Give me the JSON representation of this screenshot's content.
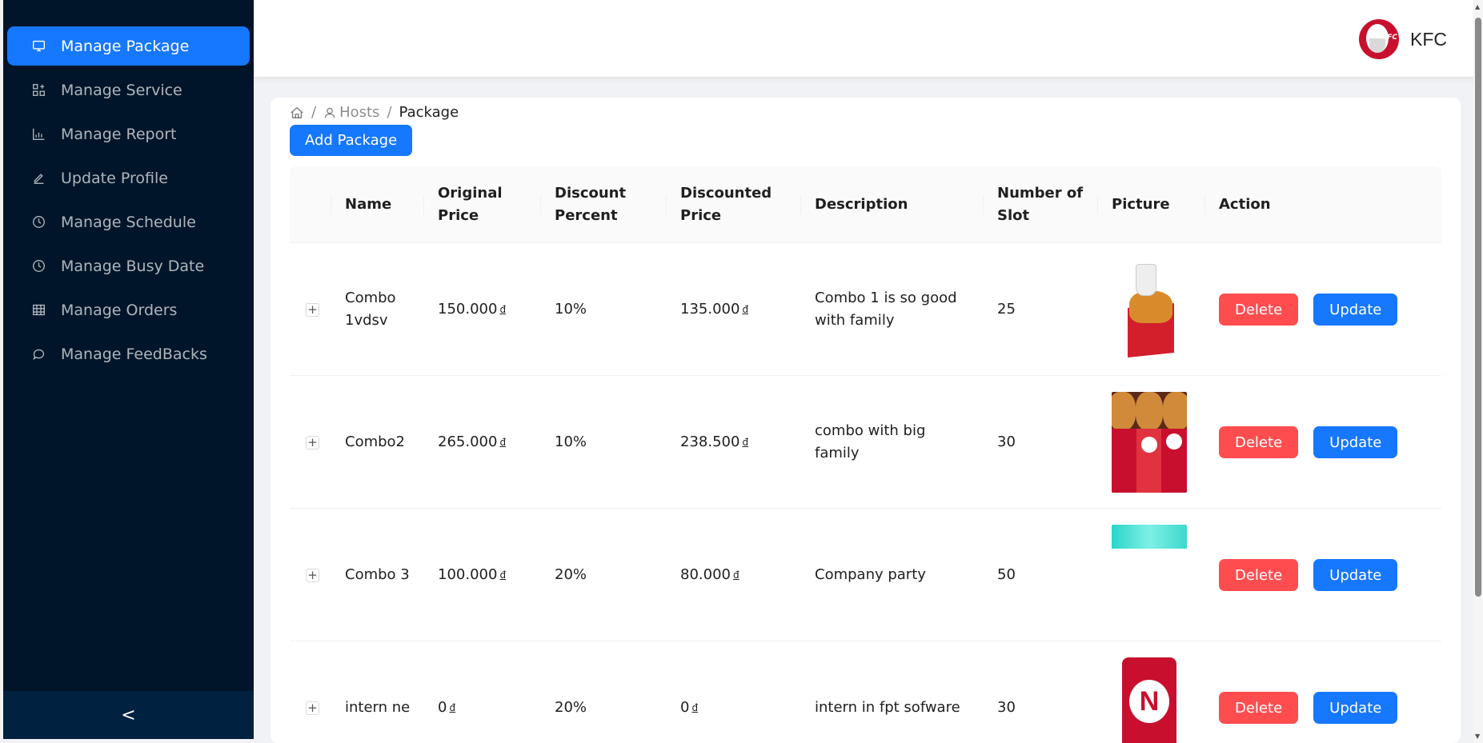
{
  "sidebar": {
    "items": [
      {
        "label": "Manage Package",
        "icon": "desktop-icon",
        "active": true
      },
      {
        "label": "Manage Service",
        "icon": "appstore-add-icon"
      },
      {
        "label": "Manage Report",
        "icon": "bar-chart-icon"
      },
      {
        "label": "Update Profile",
        "icon": "edit-icon"
      },
      {
        "label": "Manage Schedule",
        "icon": "clock-icon"
      },
      {
        "label": "Manage Busy Date",
        "icon": "clock-icon"
      },
      {
        "label": "Manage Orders",
        "icon": "table-icon"
      },
      {
        "label": "Manage FeedBacks",
        "icon": "comment-icon"
      }
    ],
    "collapse_label": "<"
  },
  "header": {
    "user_name": "KFC",
    "avatar_text": "KFC"
  },
  "breadcrumb": {
    "separator": "/",
    "items": [
      "Hosts",
      "Package"
    ]
  },
  "toolbar": {
    "add_label": "Add Package"
  },
  "table": {
    "columns": [
      "Name",
      "Original Price",
      "Discount Percent",
      "Discounted Price",
      "Description",
      "Number of Slot",
      "Picture",
      "Action"
    ],
    "rows": [
      {
        "name": "Combo 1vdsv",
        "original_price": "150.000",
        "discount": "10%",
        "discounted_price": "135.000",
        "description": "Combo 1 is so good with family",
        "slots": "25"
      },
      {
        "name": "Combo2",
        "original_price": "265.000",
        "discount": "10%",
        "discounted_price": "238.500",
        "description": "combo with big family",
        "slots": "30"
      },
      {
        "name": "Combo 3",
        "original_price": "100.000",
        "discount": "20%",
        "discounted_price": "80.000",
        "description": "Company party",
        "slots": "50"
      },
      {
        "name": "intern ne",
        "original_price": "0",
        "discount": "20%",
        "discounted_price": "0",
        "description": "intern in fpt sofware",
        "slots": "30"
      }
    ],
    "currency_symbol": "đ",
    "expand_symbol": "+",
    "delete_label": "Delete",
    "update_label": "Update"
  },
  "colors": {
    "sidebar_bg": "#001529",
    "primary": "#1677ff",
    "danger": "#ff4d4f"
  }
}
